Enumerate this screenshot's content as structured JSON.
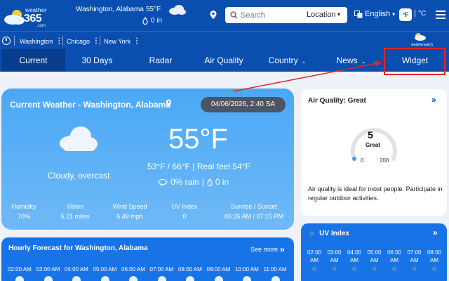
{
  "header": {
    "logo_top": "weather",
    "logo_main": "365",
    "logo_sub": ".com",
    "location": "Washington, Alabama",
    "temp": "55°F",
    "precip": "0 in",
    "search_placeholder": "Search",
    "location_select": "Location",
    "language": "English",
    "unit_f": "°F",
    "unit_sep": "|",
    "unit_c": "°C"
  },
  "saved": {
    "items": [
      {
        "label": "Washington"
      },
      {
        "label": "Chicago"
      },
      {
        "label": "New York"
      }
    ],
    "dots": "⋮",
    "partner_logo": "weatherwatch"
  },
  "nav": {
    "tabs": [
      {
        "label": "Current"
      },
      {
        "label": "30 Days"
      },
      {
        "label": "Radar"
      },
      {
        "label": "Air Quality"
      },
      {
        "label": "Country",
        "chev": "⌄"
      },
      {
        "label": "News",
        "chev": "⌄"
      },
      {
        "label": "Widget"
      }
    ]
  },
  "current": {
    "title": "Current Weather - Washington, Alabama",
    "datetime": "04/06/2026, 2:40 SA",
    "condition": "Cloudy, overcast",
    "temp": "55°F",
    "feel": "53°F / 66°F | Real feel 54°F",
    "rain": "0% rain",
    "rain_sep": "|",
    "precip": "0 in",
    "stats": [
      {
        "label": "Humidity",
        "value": "70%"
      },
      {
        "label": "Vision",
        "value": "6.21 miles"
      },
      {
        "label": "Wind Speed",
        "value": "6.49 mph"
      },
      {
        "label": "UV Index",
        "value": "0"
      },
      {
        "label": "Sunrise / Sunset",
        "value": "06:35 AM  /  07:15 PM"
      }
    ]
  },
  "air_quality": {
    "title": "Air Quality: Great",
    "more": "»",
    "value": "5",
    "word": "Great",
    "min": "0",
    "max": "200",
    "description": "Air quality is ideal for most people. Participate in regular outdoor activities."
  },
  "uv": {
    "title": "UV Index",
    "more": "»",
    "hours": [
      "02:00",
      "03:00",
      "04:00",
      "05:00",
      "06:00",
      "07:00",
      "08:00"
    ],
    "suffix": "AM",
    "sun": "☼"
  },
  "hourly": {
    "title": "Hourly Forecast for Washington, Alabama",
    "more": "See more",
    "more_chev": "»",
    "times": [
      "02:00 AM",
      "03:00 AM",
      "04:00 AM",
      "05:00 AM",
      "06:00 AM",
      "07:00 AM",
      "08:00 AM",
      "09:00 AM",
      "10:00 AM",
      "11:00 AM"
    ]
  },
  "colors": {
    "header_bg": "#0a4fb0",
    "active_tab": "#073d8c",
    "card_gradient_top": "#4aa8f5",
    "highlight_box": "#e32525",
    "uv_card": "#1873e6",
    "date_pill": "#4b5563"
  }
}
